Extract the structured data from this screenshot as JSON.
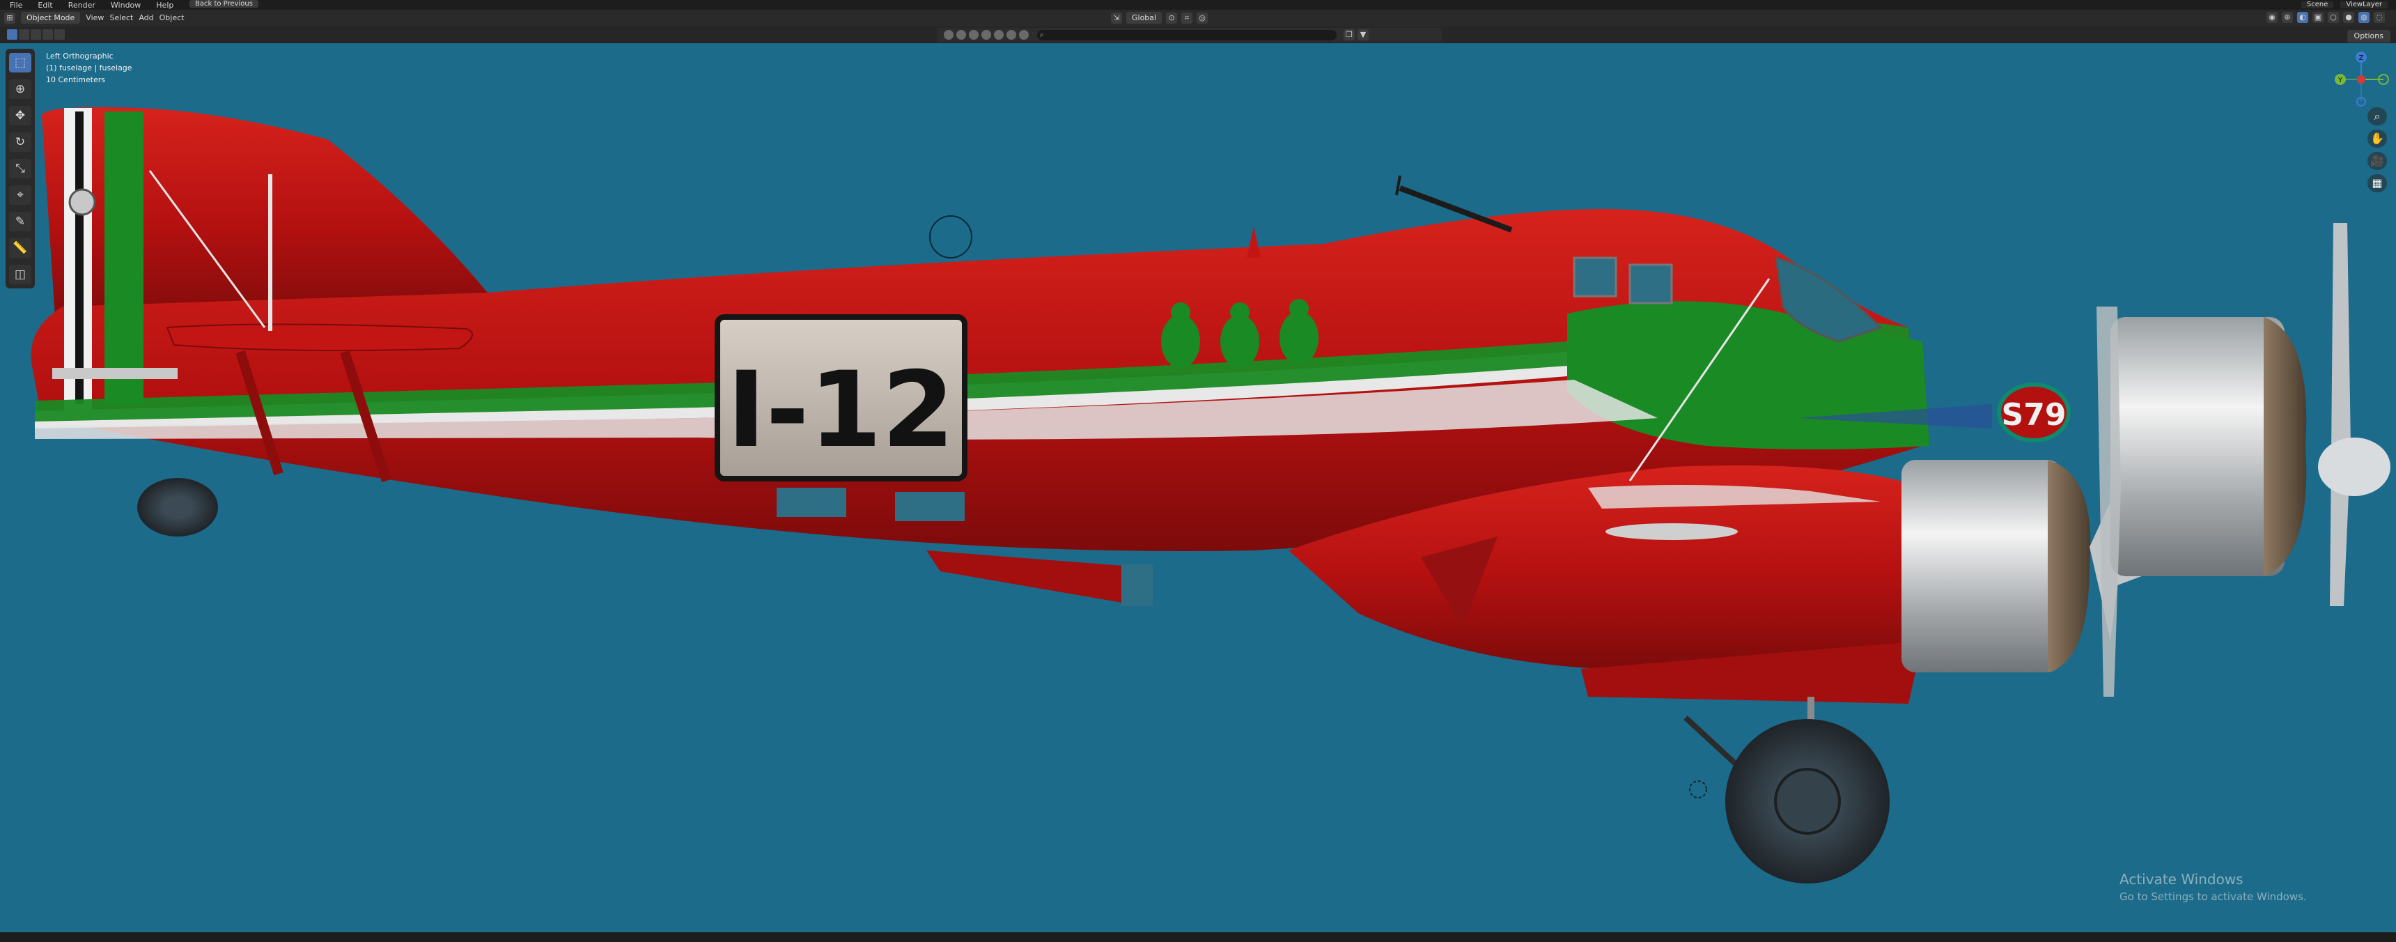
{
  "topbar": {
    "menu": [
      "File",
      "Edit",
      "Render",
      "Window",
      "Help"
    ],
    "back_button": "Back to Previous",
    "scene": "Scene",
    "view_layer": "ViewLayer"
  },
  "header": {
    "mode": "Object Mode",
    "menu": [
      "View",
      "Select",
      "Add",
      "Object"
    ],
    "orientation": "Global",
    "options": "Options"
  },
  "outliner_filter": {
    "search_placeholder": ""
  },
  "viewport": {
    "info_line1": "Left Orthographic",
    "info_line2": "(1) fuselage | fuselage",
    "info_line3": "10 Centimeters",
    "aircraft": {
      "registration": "I-12",
      "nose_marking": "S79",
      "colors": {
        "fuselage": "#b81010",
        "stripe_green": "#1a8a24",
        "stripe_white": "#e8e8e8",
        "background": "#1c6b8a"
      }
    },
    "gizmo_axes": [
      "Z",
      "Y",
      "-Y",
      "-Z"
    ]
  },
  "watermark": {
    "title": "Activate Windows",
    "subtitle": "Go to Settings to activate Windows."
  },
  "toolbar_tools": [
    "select-box",
    "cursor",
    "move",
    "rotate",
    "scale",
    "transform",
    "annotate",
    "measure",
    "add-cube"
  ]
}
